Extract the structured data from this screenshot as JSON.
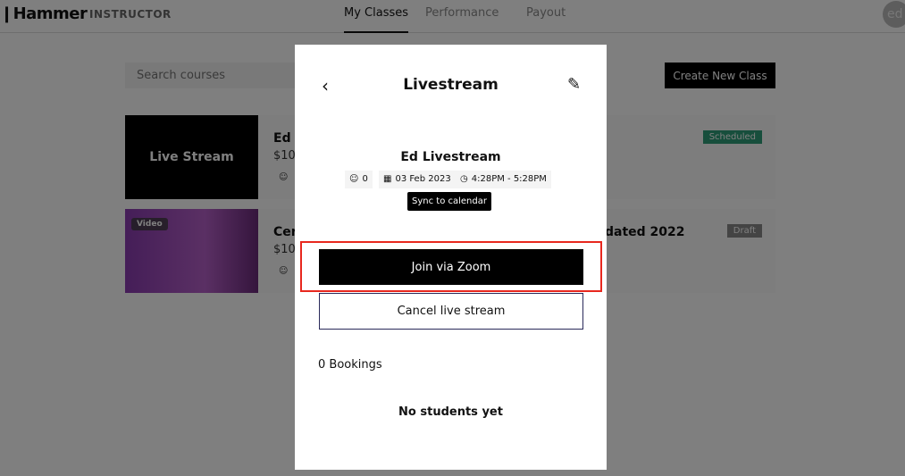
{
  "header": {
    "logo": "❙Hammer",
    "logo_sub": "INSTRUCTOR",
    "tabs": [
      {
        "label": "My Classes",
        "active": true
      },
      {
        "label": "Performance"
      },
      {
        "label": "Payout"
      }
    ],
    "avatar": "ed"
  },
  "search": {
    "placeholder": "Search courses"
  },
  "create_button": "Create New Class",
  "courses": [
    {
      "thumb": "Live Stream",
      "title": "Ed L",
      "price": "$10",
      "badge": "Scheduled",
      "badge_color": "#2e9c78"
    },
    {
      "thumb_badge": "Video",
      "title": "Cer",
      "title_tail": "dated 2022",
      "price": "$10",
      "badge": "Draft",
      "badge_color": "#888888"
    }
  ],
  "modal": {
    "title": "Livestream",
    "class_name": "Ed Livestream",
    "attendees": "0",
    "date": "03 Feb 2023",
    "time": "4:28PM - 5:28PM",
    "sync": "Sync to calendar",
    "join": "Join via Zoom",
    "cancel": "Cancel live stream",
    "bookings": "0 Bookings",
    "empty": "No students yet"
  }
}
